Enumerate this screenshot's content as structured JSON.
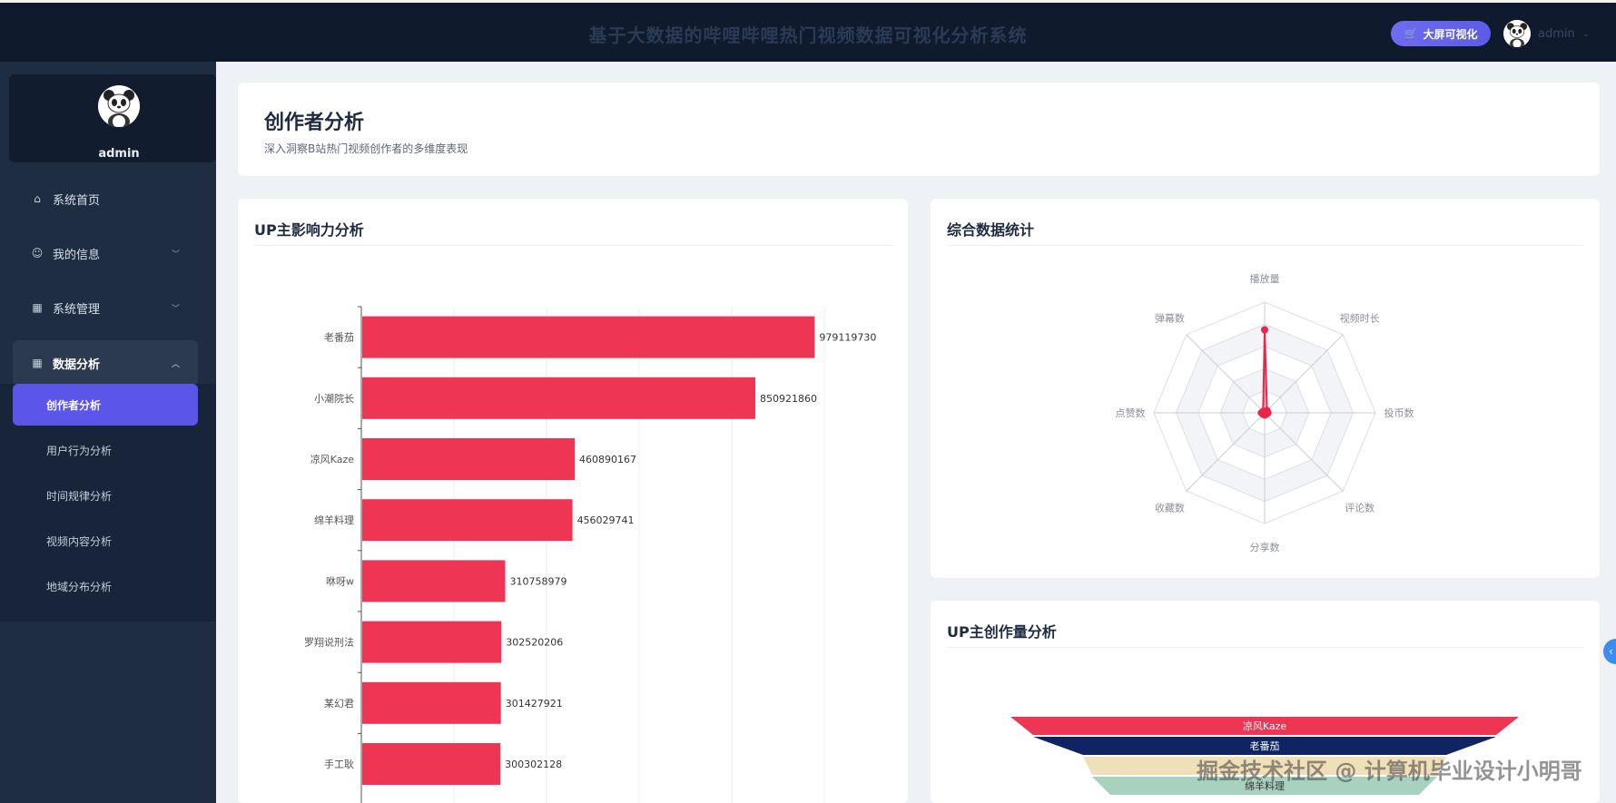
{
  "header": {
    "title": "基于大数据的哔哩哔哩热门视频数据可视化分析系统",
    "bigscreen_label": "大屏可视化",
    "user_name": "admin"
  },
  "sidebar": {
    "profile_name": "admin",
    "menu": [
      {
        "label": "系统首页",
        "icon": "home-icon"
      },
      {
        "label": "我的信息",
        "icon": "user-icon"
      },
      {
        "label": "系统管理",
        "icon": "grid-icon"
      },
      {
        "label": "数据分析",
        "icon": "grid-icon"
      }
    ],
    "submenu": [
      {
        "label": "创作者分析",
        "active": true
      },
      {
        "label": "用户行为分析"
      },
      {
        "label": "时间规律分析"
      },
      {
        "label": "视频内容分析"
      },
      {
        "label": "地域分布分析"
      }
    ]
  },
  "page": {
    "title": "创作者分析",
    "subtitle": "深入洞察B站热门视频创作者的多维度表现"
  },
  "cards": {
    "influence_title": "UP主影响力分析",
    "radar_title": "综合数据统计",
    "funnel_title": "UP主创作量分析"
  },
  "colors": {
    "bar": "#ef3554",
    "accent": "#5b55ea",
    "sidebar_bg": "#1f2d42",
    "topbar_bg": "#101a2d"
  },
  "chart_data": [
    {
      "type": "bar",
      "orientation": "horizontal",
      "categories": [
        "老番茄",
        "小潮院长",
        "凉风Kaze",
        "绵羊料理",
        "咻呀w",
        "罗翔说刑法",
        "某幻君",
        "手工耿"
      ],
      "values": [
        979119730,
        850921860,
        460890167,
        456029741,
        310758979,
        302520206,
        301427921,
        300302128
      ],
      "data_labels": [
        "979119730",
        "850921860",
        "460890167",
        "456029741",
        "310758979",
        "302520206",
        "301427921",
        "300302128"
      ],
      "xlim": [
        0,
        1000000000
      ],
      "grid": true
    },
    {
      "type": "radar",
      "indicators": [
        "播放量",
        "视频时长",
        "投币数",
        "评论数",
        "分享数",
        "收藏数",
        "点赞数",
        "弹幕数"
      ],
      "values": [
        0.75,
        0.03,
        0.03,
        0.02,
        0.02,
        0.02,
        0.03,
        0.02
      ],
      "color": "#e8264a"
    },
    {
      "type": "funnel",
      "labels": [
        "凉风Kaze",
        "老番茄",
        "",
        "绵羊料理"
      ],
      "colors": [
        "#ef3554",
        "#0f2460",
        "#efe0b9",
        "#a9d1bf"
      ]
    }
  ],
  "watermark": "掘金技术社区 @ 计算机毕业设计小明哥"
}
